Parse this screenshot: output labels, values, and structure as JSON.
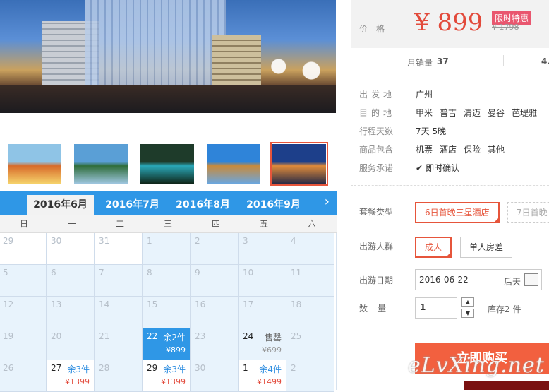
{
  "thumbnails": [
    {
      "name": "temple",
      "colors": [
        "#8fc4e6",
        "#d86b2a",
        "#f5d26b"
      ],
      "active": false
    },
    {
      "name": "pavilion",
      "colors": [
        "#5a9fd6",
        "#2f6d3a",
        "#9ec6df"
      ],
      "active": false
    },
    {
      "name": "beach",
      "colors": [
        "#1e3b2a",
        "#2aa8b8",
        "#0f2619"
      ],
      "active": false
    },
    {
      "name": "pagoda",
      "colors": [
        "#2f84d9",
        "#c98a3b",
        "#6aa6df"
      ],
      "active": false
    },
    {
      "name": "mall",
      "colors": [
        "#1d3f8a",
        "#e08b3a",
        "#2a2b45"
      ],
      "active": true
    }
  ],
  "calendar": {
    "tabs": [
      "2016年6月",
      "2016年7月",
      "2016年8月",
      "2016年9月"
    ],
    "active_tab": 0,
    "weekdays": [
      "日",
      "一",
      "二",
      "三",
      "四",
      "五",
      "六"
    ],
    "rows": [
      [
        {
          "d": "29"
        },
        {
          "d": "30"
        },
        {
          "d": "31"
        },
        {
          "d": "1"
        },
        {
          "d": "2"
        },
        {
          "d": "3"
        },
        {
          "d": "4"
        }
      ],
      [
        {
          "d": "5"
        },
        {
          "d": "6"
        },
        {
          "d": "7"
        },
        {
          "d": "8"
        },
        {
          "d": "9"
        },
        {
          "d": "10"
        },
        {
          "d": "11"
        }
      ],
      [
        {
          "d": "12"
        },
        {
          "d": "13"
        },
        {
          "d": "14"
        },
        {
          "d": "15"
        },
        {
          "d": "16"
        },
        {
          "d": "17"
        },
        {
          "d": "18"
        }
      ],
      [
        {
          "d": "19"
        },
        {
          "d": "20"
        },
        {
          "d": "21"
        },
        {
          "d": "22",
          "status": "余2件",
          "price": "¥899",
          "selected": true
        },
        {
          "d": "23"
        },
        {
          "d": "24",
          "status": "售罄",
          "price": "¥699",
          "soldout": true
        },
        {
          "d": "25"
        }
      ],
      [
        {
          "d": "26"
        },
        {
          "d": "27",
          "status": "余3件",
          "price": "¥1399"
        },
        {
          "d": "28"
        },
        {
          "d": "29",
          "status": "余3件",
          "price": "¥1399"
        },
        {
          "d": "30"
        },
        {
          "d": "1",
          "status": "余4件",
          "price": "¥1499"
        },
        {
          "d": "2"
        }
      ]
    ]
  },
  "price": {
    "label": "价格",
    "value": "¥ 899",
    "promo": "限时特惠",
    "original": "¥ 1798"
  },
  "sales": {
    "label": "月销量",
    "value": "37",
    "right": "4."
  },
  "info": {
    "depart_label": "出发地",
    "depart": "广州",
    "dest_label": "目的地",
    "dests": [
      "甲米",
      "普吉",
      "清迈",
      "曼谷",
      "芭堤雅"
    ],
    "days_label": "行程天数",
    "days": "7天 5晚",
    "includes_label": "商品包含",
    "includes": [
      "机票",
      "酒店",
      "保险",
      "其他"
    ],
    "promise_label": "服务承诺",
    "promise": "即时确认"
  },
  "options": {
    "package_label": "套餐类型",
    "packages": [
      "6日首晚三星酒店",
      "7日首晚"
    ],
    "group_label": "出游人群",
    "groups": [
      "成人",
      "单人房差"
    ],
    "date_label": "出游日期",
    "date_value": "2016-06-22",
    "date_hint": "后天",
    "qty_label": "数量",
    "qty_value": "1",
    "stock": "库存2 件",
    "buy": "立即购买"
  },
  "watermark": "eLvXing.net",
  "colors": {
    "accent": "#e6553b",
    "blue": "#2f97e6",
    "price": "#e24a3b"
  }
}
